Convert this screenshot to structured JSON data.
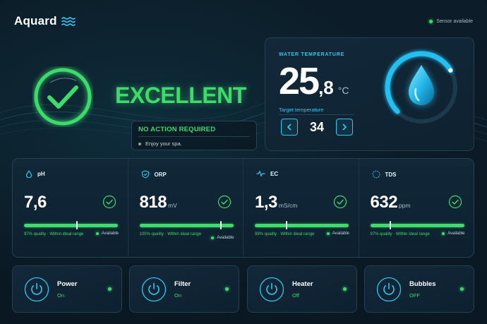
{
  "header": {
    "app_name": "Aquard",
    "sensor_status": "Sensor available"
  },
  "status": {
    "word": "EXCELLENT",
    "title": "NO ACTION REQUIRED",
    "message": "Enjoy your spa."
  },
  "water": {
    "label": "WATER TEMPERATURE",
    "temp_int": "25",
    "temp_dec": ",8",
    "unit": "°C",
    "target_label": "Target temperature",
    "target_value": "34",
    "gauge_fraction": 0.72
  },
  "metrics": [
    {
      "icon": "droplet-icon",
      "name": "pH",
      "value": "7,6",
      "unit": "",
      "quality": "97% quality · Within ideal range",
      "availability": "Available",
      "marker": 0.56
    },
    {
      "icon": "shield-check-icon",
      "name": "ORP",
      "value": "818",
      "unit": "mV",
      "quality": "100% quality · Within ideal range",
      "availability": "Available",
      "marker": 0.86
    },
    {
      "icon": "pulse-icon",
      "name": "EC",
      "value": "1,3",
      "unit": "mS/cm",
      "quality": "99% quality · Within ideal range",
      "availability": "Available",
      "marker": 0.33
    },
    {
      "icon": "dotted-circle-icon",
      "name": "TDS",
      "value": "632",
      "unit": "ppm",
      "quality": "97% quality · Within ideal range",
      "availability": "Available",
      "marker": 0.21
    }
  ],
  "controls": [
    {
      "icon": "power-icon",
      "title": "Power",
      "state": "On"
    },
    {
      "icon": "power-icon",
      "title": "Filter",
      "state": "On"
    },
    {
      "icon": "power-icon",
      "title": "Heater",
      "state": "Off"
    },
    {
      "icon": "power-icon",
      "title": "Bubbles",
      "state": "OFF"
    }
  ],
  "colors": {
    "accent_green": "#3ddc6a",
    "accent_blue": "#34c5ec",
    "background": "#0b1a25"
  }
}
